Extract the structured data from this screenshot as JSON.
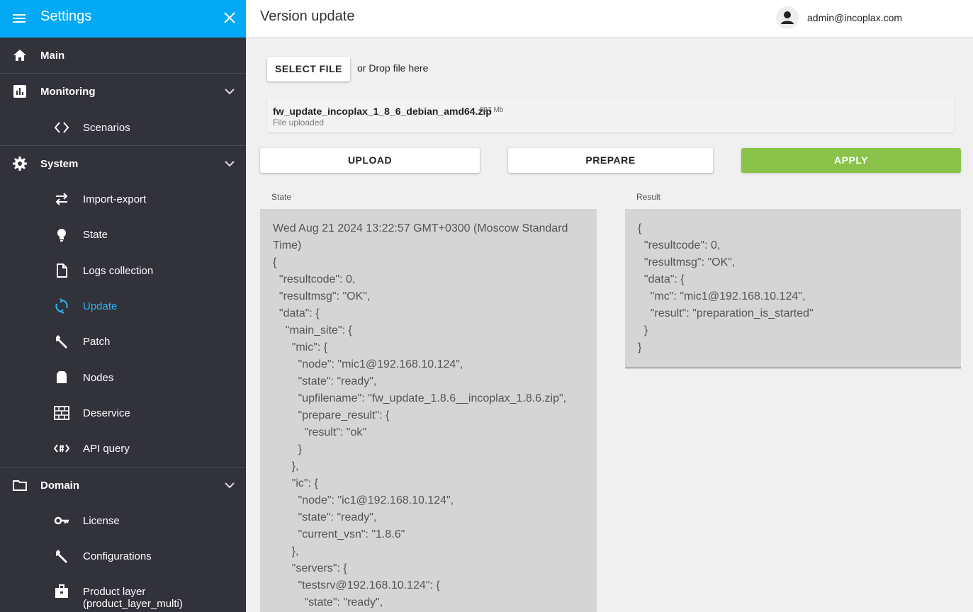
{
  "sidebar": {
    "title": "Settings",
    "groups": [
      {
        "label": "Main",
        "icon": "home-icon"
      },
      {
        "label": "Monitoring",
        "icon": "bar-chart-icon",
        "items": [
          {
            "label": "Scenarios",
            "icon": "code-icon"
          }
        ]
      },
      {
        "label": "System",
        "icon": "gear-icon",
        "items": [
          {
            "label": "Import-export",
            "icon": "swap-icon"
          },
          {
            "label": "State",
            "icon": "lightbulb-icon"
          },
          {
            "label": "Logs collection",
            "icon": "file-icon"
          },
          {
            "label": "Update",
            "icon": "sync-icon",
            "active": true
          },
          {
            "label": "Patch",
            "icon": "wrench-icon"
          },
          {
            "label": "Nodes",
            "icon": "box-icon"
          },
          {
            "label": "Deservice",
            "icon": "firewall-icon"
          },
          {
            "label": "API query",
            "icon": "api-icon"
          }
        ]
      },
      {
        "label": "Domain",
        "icon": "folder-icon",
        "items": [
          {
            "label": "License",
            "icon": "key-icon"
          },
          {
            "label": "Configurations",
            "icon": "wrench-icon"
          },
          {
            "label": "Product layer (product_layer_multi)",
            "icon": "briefcase-icon"
          }
        ]
      }
    ]
  },
  "header": {
    "title": "Version update",
    "user": "admin@incoplax.com"
  },
  "upload": {
    "select_label": "SELECT FILE",
    "drop_text": "or Drop file here",
    "file_name": "fw_update_incoplax_1_8_6_debian_amd64.zip",
    "file_size": "527 Mb",
    "file_status": "File uploaded"
  },
  "actions": {
    "upload": "UPLOAD",
    "prepare": "PREPARE",
    "apply": "APPLY",
    "apply_color": "#8bc34a"
  },
  "state": {
    "label": "State",
    "text": "Wed Aug 21 2024 13:22:57 GMT+0300 (Moscow Standard Time)\n{\n  \"resultcode\": 0,\n  \"resultmsg\": \"OK\",\n  \"data\": {\n    \"main_site\": {\n      \"mic\": {\n        \"node\": \"mic1@192.168.10.124\",\n        \"state\": \"ready\",\n        \"upfilename\": \"fw_update_1.8.6__incoplax_1.8.6.zip\",\n        \"prepare_result\": {\n          \"result\": \"ok\"\n        }\n      },\n      \"ic\": {\n        \"node\": \"ic1@192.168.10.124\",\n        \"state\": \"ready\",\n        \"current_vsn\": \"1.8.6\"\n      },\n      \"servers\": {\n        \"testsrv@192.168.10.124\": {\n          \"state\": \"ready\","
  },
  "result": {
    "label": "Result",
    "text": "{\n  \"resultcode\": 0,\n  \"resultmsg\": \"OK\",\n  \"data\": {\n    \"mc\": \"mic1@192.168.10.124\",\n    \"result\": \"preparation_is_started\"\n  }\n}"
  },
  "colors": {
    "sidebar_bg": "#32323a",
    "header_accent": "#03a9f4",
    "active_item": "#29b6f6"
  }
}
